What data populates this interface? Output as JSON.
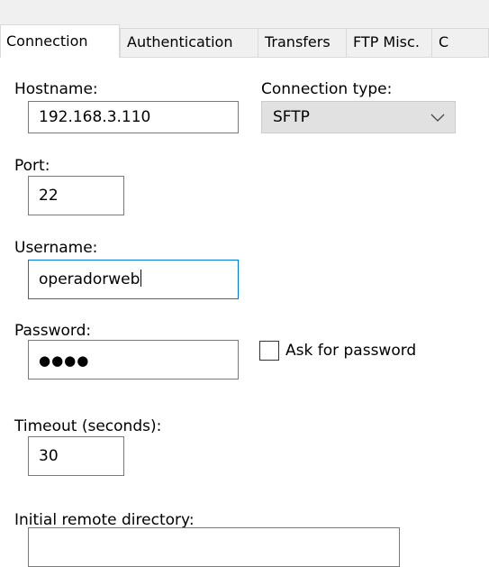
{
  "tabs": [
    {
      "label": "Connection",
      "active": true
    },
    {
      "label": "Authentication",
      "active": false
    },
    {
      "label": "Transfers",
      "active": false
    },
    {
      "label": "FTP Misc.",
      "active": false
    },
    {
      "label": "C",
      "active": false
    }
  ],
  "hostname": {
    "label": "Hostname:",
    "value": "192.168.3.110"
  },
  "connection_type": {
    "label": "Connection type:",
    "selected": "SFTP"
  },
  "port": {
    "label": "Port:",
    "value": "22"
  },
  "username": {
    "label": "Username:",
    "value": "operadorweb"
  },
  "password": {
    "label": "Password:",
    "masked_value": "●●●●",
    "ask_label": "Ask for password",
    "ask_checked": false
  },
  "timeout": {
    "label": "Timeout (seconds):",
    "value": "30"
  },
  "remote_dir": {
    "label": "Initial remote directory:",
    "value": ""
  }
}
